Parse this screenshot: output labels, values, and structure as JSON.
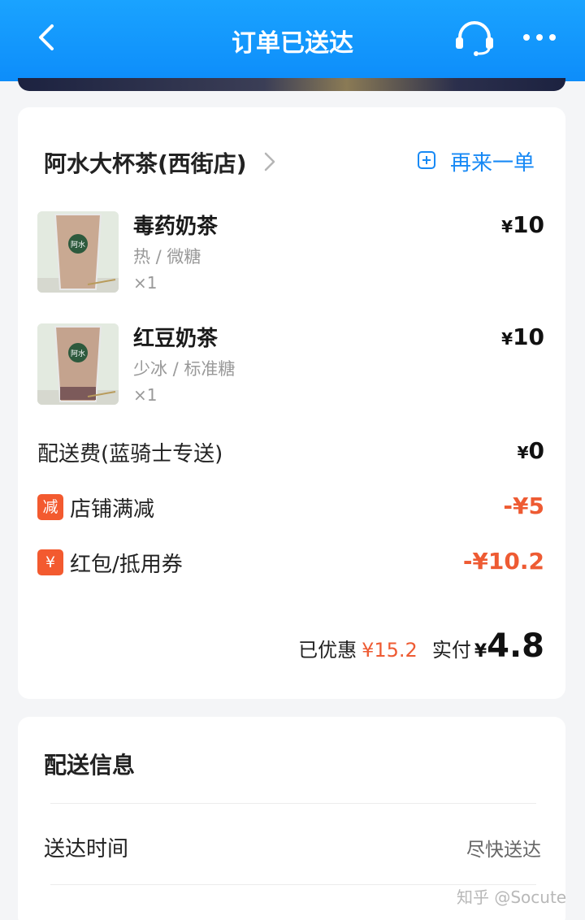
{
  "header": {
    "title": "订单已送达",
    "back_icon": "chevron-left-icon",
    "service_icon": "headset-icon",
    "more_icon": "more-dots-icon"
  },
  "order": {
    "shop_name": "阿水大杯茶(西街店)",
    "reorder_label": "再来一单",
    "items": [
      {
        "name": "毒药奶茶",
        "spec": "热 / 微糖",
        "qty": "×1",
        "currency": "¥",
        "price": "10",
        "cup_text": "阿水"
      },
      {
        "name": "红豆奶茶",
        "spec": "少冰 / 标准糖",
        "qty": "×1",
        "currency": "¥",
        "price": "10",
        "cup_text": "阿水"
      }
    ],
    "delivery_fee": {
      "label": "配送费(蓝骑士专送)",
      "currency": "¥",
      "amount": "0"
    },
    "discounts": [
      {
        "badge": "减",
        "label": "店铺满减",
        "amount": "-¥5"
      },
      {
        "badge": "¥",
        "label": "红包/抵用券",
        "amount": "-¥10.2"
      }
    ],
    "summary": {
      "saved_label": "已优惠",
      "saved_amount": "¥15.2",
      "paid_label": "实付",
      "currency": "¥",
      "total": "4.8"
    }
  },
  "delivery_info": {
    "title": "配送信息",
    "rows": [
      {
        "label": "送达时间",
        "value": "尽快送达"
      }
    ]
  },
  "watermark": "知乎 @Socute",
  "colors": {
    "header_blue": "#0d8dfa",
    "accent_blue": "#1789f5",
    "discount_red": "#ee5b33",
    "badge_orange": "#f35a2f"
  }
}
